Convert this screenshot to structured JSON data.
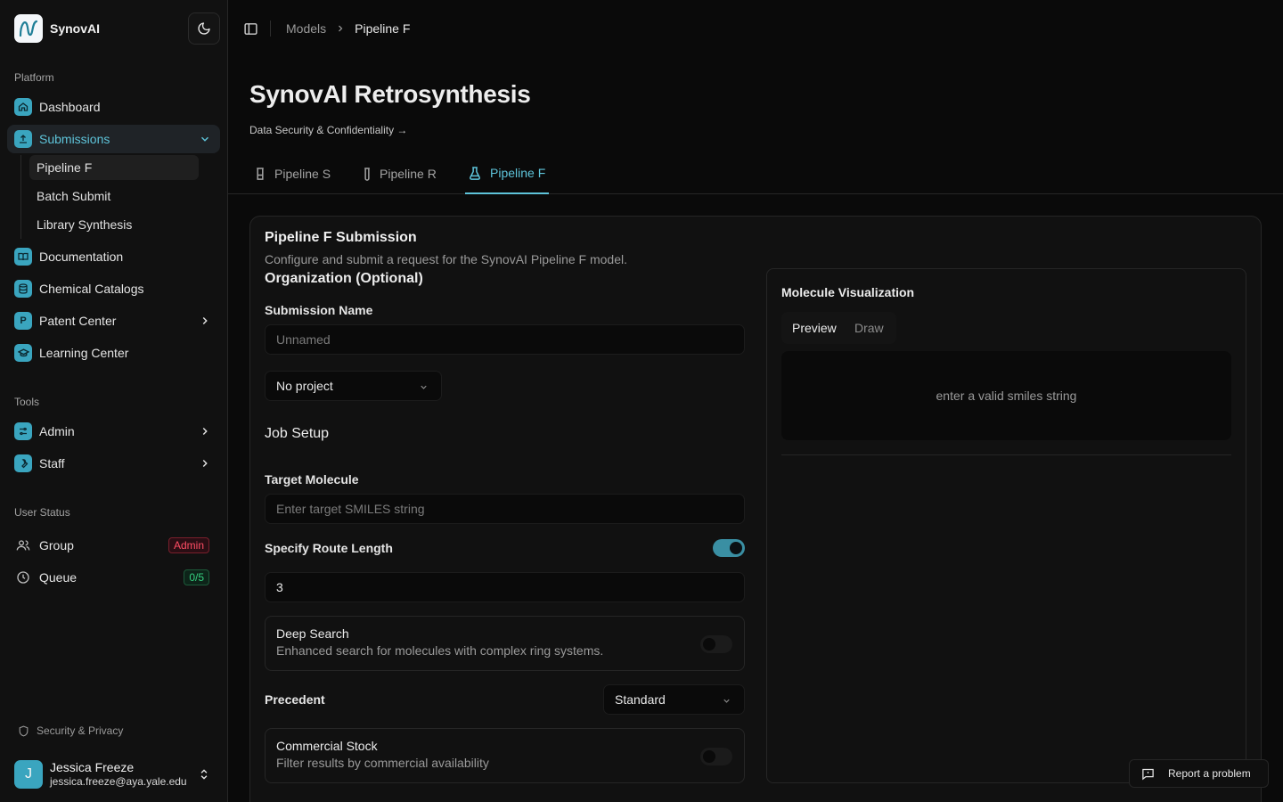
{
  "app": {
    "name": "SynovAI"
  },
  "sidebar": {
    "platform_label": "Platform",
    "tools_label": "Tools",
    "user_status_label": "User Status",
    "items": [
      {
        "label": "Dashboard",
        "icon": "home-icon"
      },
      {
        "label": "Submissions",
        "icon": "upload-icon",
        "active": true
      },
      {
        "label": "Documentation",
        "icon": "book-icon"
      },
      {
        "label": "Chemical Catalogs",
        "icon": "database-icon"
      },
      {
        "label": "Patent Center",
        "icon": "patent-icon",
        "icon_letter": "P"
      },
      {
        "label": "Learning Center",
        "icon": "graduation-cap-icon"
      }
    ],
    "submission_subitems": [
      {
        "label": "Pipeline F",
        "active": true
      },
      {
        "label": "Batch Submit"
      },
      {
        "label": "Library Synthesis"
      }
    ],
    "tools": [
      {
        "label": "Admin",
        "icon": "settings-sliders-icon"
      },
      {
        "label": "Staff",
        "icon": "wrench-icon"
      }
    ],
    "status": {
      "group_label": "Group",
      "group_badge": "Admin",
      "queue_label": "Queue",
      "queue_badge": "0/5"
    },
    "security_link": "Security & Privacy",
    "user": {
      "initial": "J",
      "name": "Jessica Freeze",
      "email": "jessica.freeze@aya.yale.edu"
    }
  },
  "breadcrumb": {
    "parent": "Models",
    "current": "Pipeline F"
  },
  "page": {
    "title": "SynovAI Retrosynthesis",
    "link": "Data Security & Confidentiality →"
  },
  "tabs": [
    {
      "label": "Pipeline S"
    },
    {
      "label": "Pipeline R"
    },
    {
      "label": "Pipeline F",
      "active": true
    }
  ],
  "form": {
    "title": "Pipeline F Submission",
    "description": "Configure and submit a request for the SynovAI Pipeline F model.",
    "org_label": "Organization (Optional)",
    "submission_name_label": "Submission Name",
    "submission_name_placeholder": "Unnamed",
    "project_select": "No project",
    "job_setup_label": "Job Setup",
    "target_label": "Target Molecule",
    "target_placeholder": "Enter target SMILES string",
    "route_length_label": "Specify Route Length",
    "route_length_enabled": true,
    "route_length_value": "3",
    "deep_search": {
      "title": "Deep Search",
      "description": "Enhanced search for molecules with complex ring systems.",
      "enabled": false
    },
    "precedent_label": "Precedent",
    "precedent_value": "Standard",
    "commercial_stock": {
      "title": "Commercial Stock",
      "description": "Filter results by commercial availability",
      "enabled": false
    }
  },
  "molecule": {
    "title": "Molecule Visualization",
    "tab_preview": "Preview",
    "tab_draw": "Draw",
    "empty_message": "enter a valid smiles string"
  },
  "report_button": "Report a problem",
  "colors": {
    "accent": "#5ec4da",
    "icon_bg": "#3aa5bf",
    "admin_badge": "#ff4d64",
    "queue_badge": "#35d07f",
    "background": "#0a0a0a",
    "card": "#111111"
  }
}
